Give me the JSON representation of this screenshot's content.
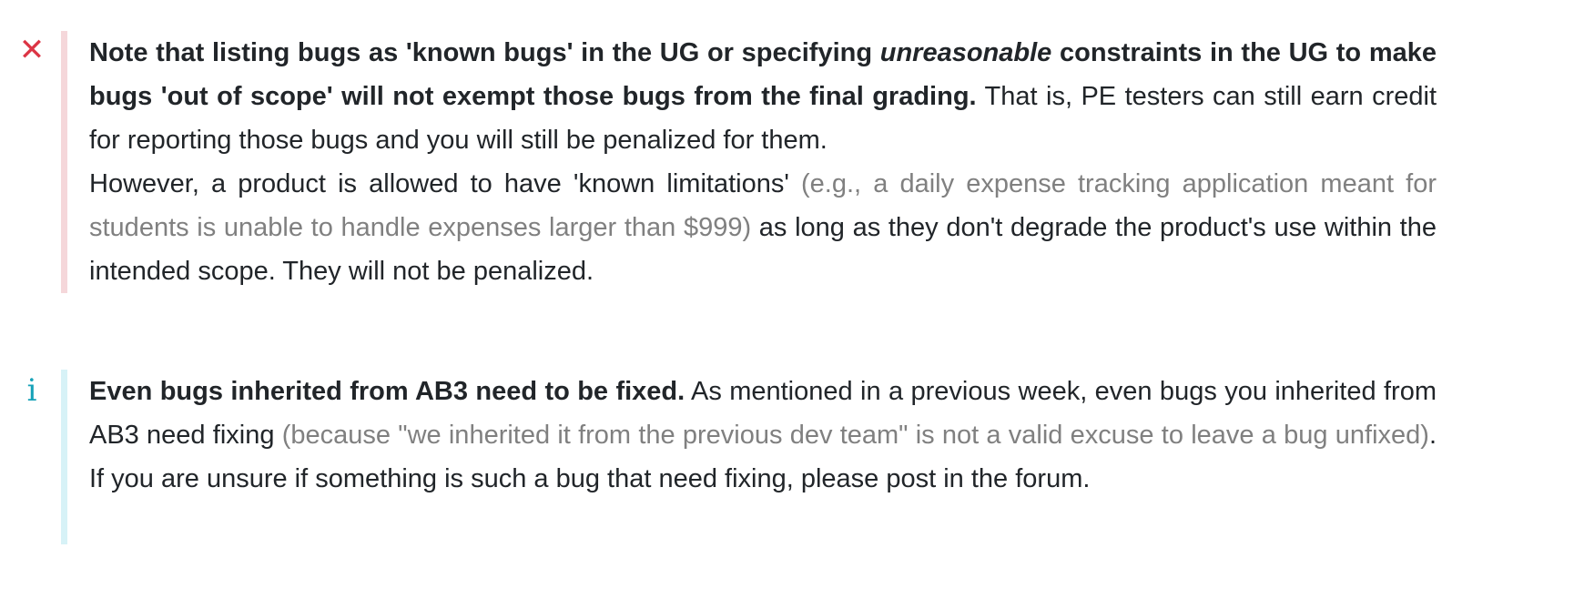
{
  "wrong_box": {
    "icon": "close-icon",
    "icon_glyph": "✕",
    "accent_color": "#dc3545",
    "bar_color": "#f5d7da",
    "p1_bold_a": "Note that listing bugs as 'known bugs' in the UG or specifying ",
    "p1_italic": "unreasonable",
    "p1_bold_b": " constraints in the UG to make bugs 'out of scope' will not exempt those bugs from the final grading.",
    "p1_rest": " That is, PE testers can still earn credit for reporting those bugs and you will still be penalized for them.",
    "p2_a": "However, a product is allowed to have 'known limitations' ",
    "p2_muted": "(e.g., a daily expense tracking application meant for students is unable to handle expenses larger than $999)",
    "p2_b": " as long as they don't degrade the product's use within the intended scope. They will not be penalized."
  },
  "info_box": {
    "icon": "info-icon",
    "icon_glyph": "i",
    "accent_color": "#17a2b8",
    "bar_color": "#d7f2f7",
    "bold": "Even bugs inherited from AB3 need to be fixed.",
    "text_a": " As mentioned in a previous week, even bugs you inherited from AB3 need fixing ",
    "muted": "(because \"we inherited it from the previous dev team\" is not a valid excuse to leave a bug unfixed)",
    "text_b": ". If you are unsure if something is such a bug that need fixing, please post in the forum."
  }
}
